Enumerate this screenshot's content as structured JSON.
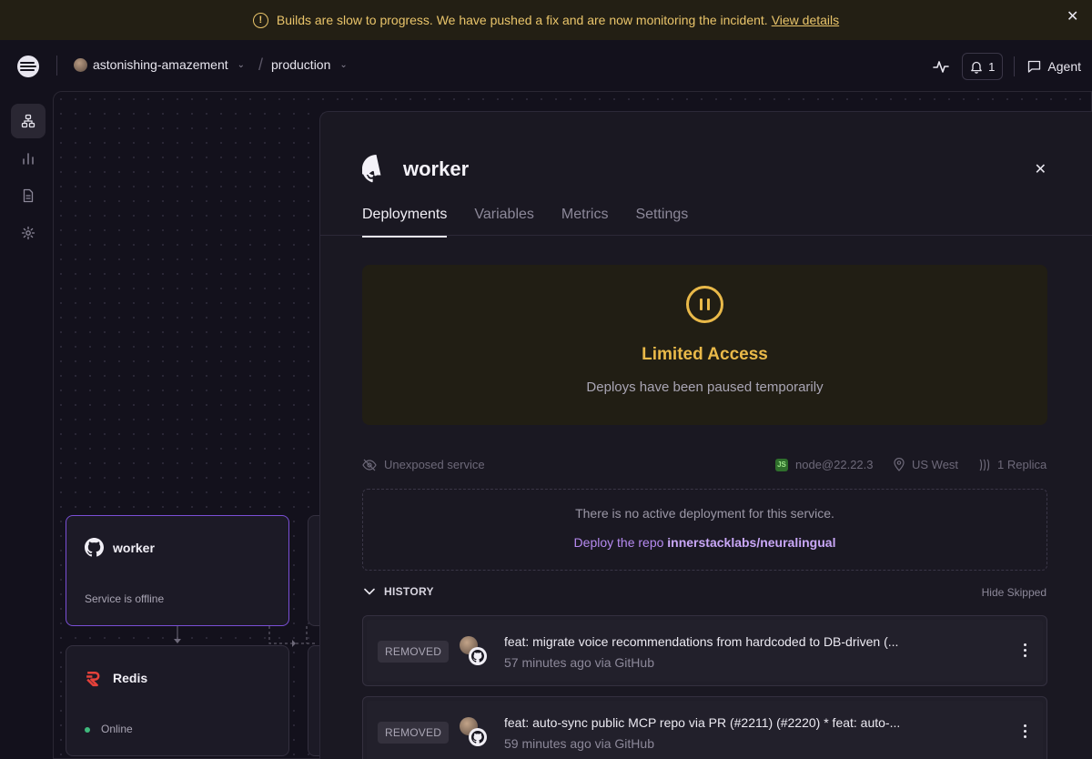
{
  "banner": {
    "message": "Builds are slow to progress. We have pushed a fix and are now monitoring the incident.",
    "link": "View details",
    "warn_glyph": "!",
    "close_glyph": "✕",
    "color": "#e9c46a"
  },
  "nav": {
    "project": "astonishing-amazement",
    "separator": "/",
    "environment": "production",
    "chevron_glyph": "⌄",
    "notifications_count": "1",
    "agent_label": "Agent"
  },
  "sidebar": {
    "items": [
      {
        "icon": "architecture-icon",
        "active": true
      },
      {
        "icon": "observability-icon",
        "active": false
      },
      {
        "icon": "logs-icon",
        "active": false
      },
      {
        "icon": "settings-icon",
        "active": false
      }
    ]
  },
  "canvas": {
    "nodes": [
      {
        "name": "worker",
        "status": "Service is offline",
        "icon": "github-icon",
        "selected": true
      },
      {
        "name": "Redis",
        "status": "Online",
        "icon": "redis-icon",
        "selected": false
      }
    ]
  },
  "panel": {
    "title": "worker",
    "close_glyph": "✕",
    "tabs": [
      "Deployments",
      "Variables",
      "Metrics",
      "Settings"
    ],
    "active_tab": "Deployments",
    "limited": {
      "title": "Limited Access",
      "subtitle": "Deploys have been paused temporarily",
      "color": "#e9b949"
    },
    "meta": {
      "exposure": "Unexposed service",
      "runtime": "node@22.22.3",
      "runtime_badge": "JS",
      "region": "US West",
      "replicas": "1 Replica"
    },
    "no_deployment": {
      "message": "There is no active deployment for this service.",
      "cta_prefix": "Deploy the repo",
      "repo": "innerstacklabs/neuralingual"
    },
    "history": {
      "label": "HISTORY",
      "hide_skipped": "Hide Skipped",
      "rows": [
        {
          "status": "REMOVED",
          "title": "feat: migrate voice recommendations from hardcoded to DB-driven (...",
          "time": "57 minutes ago via GitHub"
        },
        {
          "status": "REMOVED",
          "title": "feat: auto-sync public MCP repo via PR (#2211) (#2220) * feat: auto-...",
          "time": "59 minutes ago via GitHub"
        }
      ]
    }
  }
}
